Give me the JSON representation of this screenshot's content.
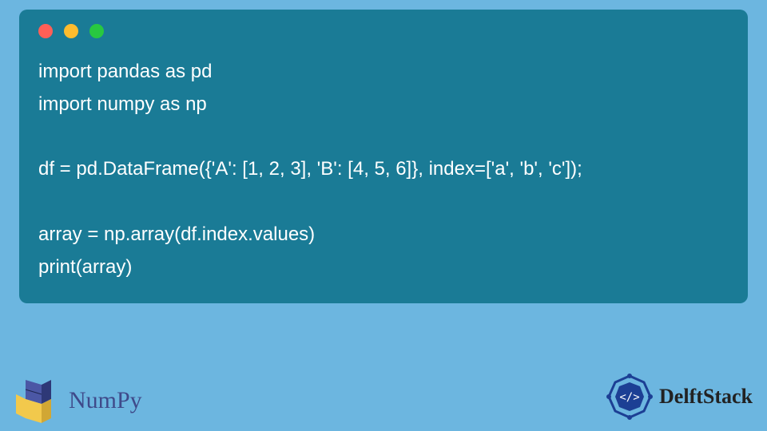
{
  "code": {
    "lines": [
      "import pandas as pd",
      "import numpy as np",
      "",
      "df = pd.DataFrame({'A': [1, 2, 3], 'B': [4, 5, 6]}, index=['a', 'b', 'c']);",
      "",
      "array = np.array(df.index.values)",
      "print(array)"
    ]
  },
  "logos": {
    "numpy_label": "NumPy",
    "delftstack_label": "DelftStack"
  },
  "colors": {
    "page_bg": "#6cb6e0",
    "card_bg": "#1a7b96",
    "code_fg": "#ffffff",
    "numpy_text": "#3f4a8a",
    "delftstack_accent": "#1c3f94"
  }
}
